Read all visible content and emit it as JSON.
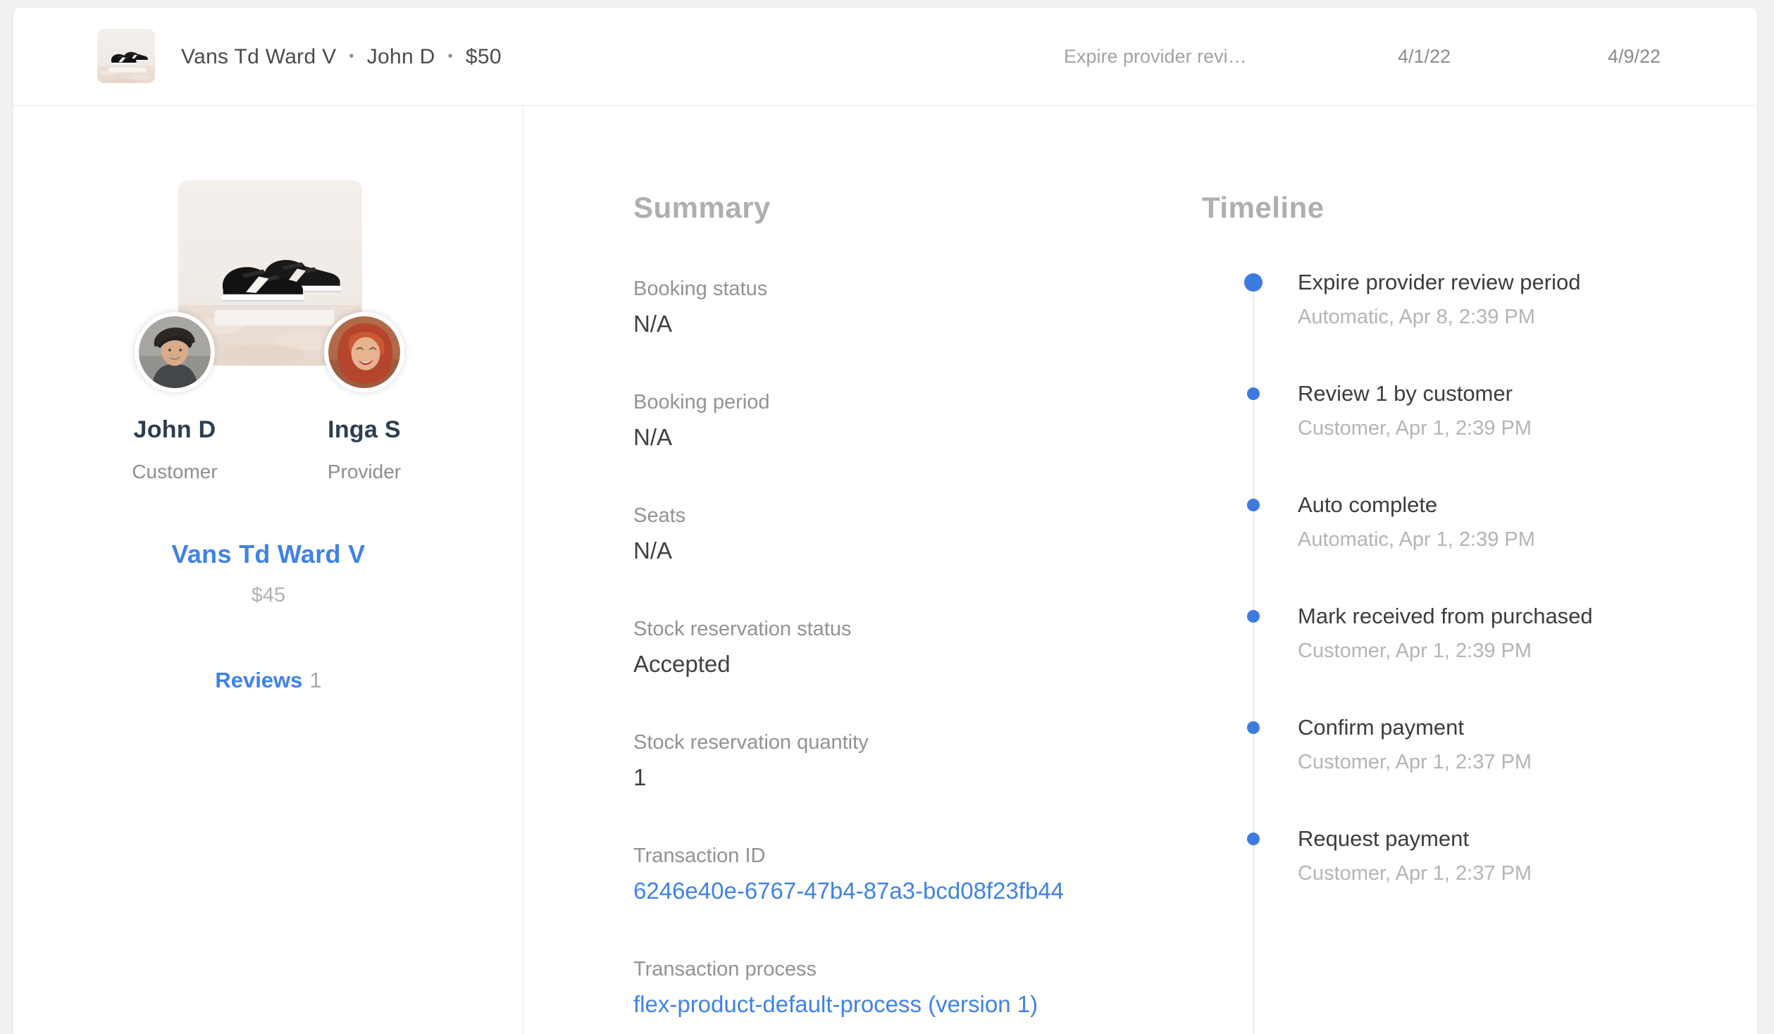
{
  "header": {
    "listing_title": "Vans Td Ward V",
    "separator": "•",
    "customer_name": "John D",
    "price": "$50",
    "last_transition": "Expire provider revi…",
    "start_date": "4/1/22",
    "end_date": "4/9/22"
  },
  "sidebar": {
    "customer": {
      "name": "John D",
      "role": "Customer"
    },
    "provider": {
      "name": "Inga S",
      "role": "Provider"
    },
    "listing": {
      "title": "Vans Td Ward V",
      "price": "$45"
    },
    "reviews": {
      "label": "Reviews",
      "count": "1"
    }
  },
  "summary": {
    "heading": "Summary",
    "fields": [
      {
        "label": "Booking status",
        "value": "N/A"
      },
      {
        "label": "Booking period",
        "value": "N/A"
      },
      {
        "label": "Seats",
        "value": "N/A"
      },
      {
        "label": "Stock reservation status",
        "value": "Accepted"
      },
      {
        "label": "Stock reservation quantity",
        "value": "1"
      },
      {
        "label": "Transaction ID",
        "value": "6246e40e-6767-47b4-87a3-bcd08f23fb44"
      },
      {
        "label": "Transaction process",
        "value": "flex-product-default-process (version 1)"
      }
    ]
  },
  "timeline": {
    "heading": "Timeline",
    "events": [
      {
        "title": "Expire provider review period",
        "meta": "Automatic, Apr 8, 2:39 PM"
      },
      {
        "title": "Review 1 by customer",
        "meta": "Customer, Apr 1, 2:39 PM"
      },
      {
        "title": "Auto complete",
        "meta": "Automatic, Apr 1, 2:39 PM"
      },
      {
        "title": "Mark received from purchased",
        "meta": "Customer, Apr 1, 2:39 PM"
      },
      {
        "title": "Confirm payment",
        "meta": "Customer, Apr 1, 2:37 PM"
      },
      {
        "title": "Request payment",
        "meta": "Customer, Apr 1, 2:37 PM"
      }
    ]
  },
  "colors": {
    "accent_blue": "#3f82e8",
    "timeline_dot": "#3d7be0",
    "name_navy": "#2d3e51",
    "card_background": "#ffffff",
    "page_background": "#f1f1f1"
  }
}
